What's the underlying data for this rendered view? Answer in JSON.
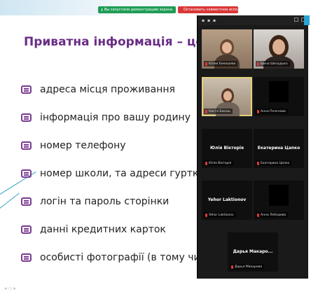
{
  "slide": {
    "title": "Приватна інформація – це:",
    "bullets": [
      "адреса місця проживання",
      "інформація про вашу родину",
      "номер телефону",
      "номер школи, та адреси гуртків",
      "логін та пароль сторінки",
      "данні кредитних карток",
      "особисті фотографії (в тому числі інтимн"
    ]
  },
  "share_bar": {
    "sharing_label": "Вы запустили демонстрацию экрана",
    "stop_label": "Остановить совместное использование"
  },
  "gallery": {
    "participants": [
      {
        "label": "Юлия Бекешева",
        "display": "",
        "video": true
      },
      {
        "label": "Ірина Шелудько",
        "display": "",
        "video": true
      },
      {
        "label": "Настя Бекеш",
        "display": "",
        "video": true
      },
      {
        "label": "Анна Пелєнова",
        "display": "",
        "video": false
      },
      {
        "label": "Юлія Вікторія",
        "display": "Юлія Вікторія",
        "video": false
      },
      {
        "label": "Екатерина Цапко",
        "display": "Екатерина Цапко",
        "video": false
      },
      {
        "label": "Yehor Laktionov",
        "display": "Yehor Laktionov",
        "video": false
      },
      {
        "label": "Анна Лебедева",
        "display": "",
        "video": false
      },
      {
        "label": "Дарья Макарова",
        "display": "Дарья Макаро...",
        "video": false
      }
    ]
  },
  "colors": {
    "title": "#6a2d86",
    "bullet_icon": "#7a3a93",
    "share_green": "#1f9d55",
    "share_red": "#d93838",
    "active_speaker": "#e3d07a"
  }
}
